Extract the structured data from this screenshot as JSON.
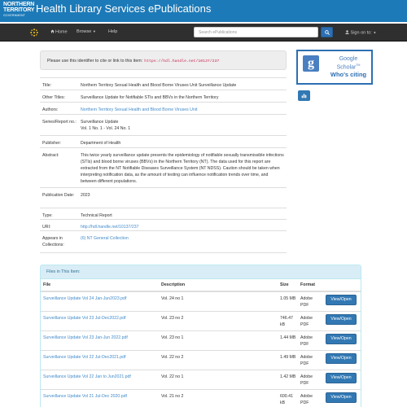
{
  "banner": {
    "logo_line1": "NORTHERN",
    "logo_line2": "TERRITORY",
    "logo_line3": "GOVERNMENT",
    "title": "Health Library Services ePublications",
    "background": "#1d7ab8"
  },
  "navbar": {
    "home": "Home",
    "browse": "Browse",
    "help": "Help",
    "search_placeholder": "Search ePublications",
    "sign_on": "Sign on to:",
    "background": "#2f2f2f"
  },
  "citation": {
    "prompt": "Please use this identifier to cite or link to this item:",
    "url": "https://hdl.handle.net/10137/237"
  },
  "metadata": [
    {
      "label": "Title:",
      "value": "Northern Territory Sexual Health and Blood Borne Viruses Unit Surveillance Update",
      "link": false
    },
    {
      "label": "Other Titles:",
      "value": "Surveillance Update for Notifiable STIs and BBVs in the Northern Territory",
      "link": false
    },
    {
      "label": "Authors:",
      "value": "Northern Territory Sexual Health and Blood Borne Viruses Unit",
      "link": true
    },
    {
      "label": "Series/Report no.:",
      "value": "Surveillance Update\nVol. 1 No. 1 - Vol. 24 No. 1",
      "link": false
    },
    {
      "label": "Publisher:",
      "value": "Department of Health",
      "link": false
    },
    {
      "label": "Abstract:",
      "value": "This twice yearly surveillance update presents the epidemiology of notifiable sexually transmissible infections (STIs) and blood borne viruses (BBVs) in the Northern Territory (NT). The data used for this report are extracted from the NT Notifiable Diseases Surveillance System (NT NDSS). Caution should be taken when interpreting notification data, as the amount of testing can influence notification trends over time, and between different populations.",
      "link": false
    },
    {
      "label": "Publication Date:",
      "value": "2023",
      "link": false
    },
    {
      "label": "Type:",
      "value": "Technical Report",
      "link": false
    },
    {
      "label": "URI:",
      "value": "http://hdl.handle.net/10137/237",
      "link": true
    },
    {
      "label": "Appears in Collections:",
      "value": "(6) NT General Collection",
      "link": true
    }
  ],
  "scholar": {
    "google": "Google",
    "scholar": "Scholar",
    "tm": "TM",
    "whos_citing": "Who's citing"
  },
  "files": {
    "heading": "Files in This Item:",
    "columns": [
      "File",
      "Description",
      "Size",
      "Format"
    ],
    "button_label": "View/Open",
    "rows": [
      {
        "file": "Surveillance Update Vol 24 Jan-Jun2023.pdf",
        "description": "Vol. 24 no 1",
        "size": "1.05 MB",
        "format": "Adobe PDF"
      },
      {
        "file": "Surveillance Update Vol 23 Jul-Dec2022.pdf",
        "description": "Vol. 23 no 2",
        "size": "746.47 kB",
        "format": "Adobe PDF"
      },
      {
        "file": "Surveillance Update Vol 23 Jan-Jun 2022.pdf",
        "description": "Vol. 23 no 1",
        "size": "1.44 MB",
        "format": "Adobe PDF"
      },
      {
        "file": "Surveillance Update Vol 22 Jul-Dec2021.pdf",
        "description": "Vol. 22 no 2",
        "size": "1.49 MB",
        "format": "Adobe PDF"
      },
      {
        "file": "Surveillance Update Vol 22 Jan to Jun2021.pdf",
        "description": "Vol. 22 no 1",
        "size": "1.42 MB",
        "format": "Adobe PDF"
      },
      {
        "file": "Surveillance Update Vol 21 Jul-Dec 2020.pdf",
        "description": "Vol. 21 no 2",
        "size": "600.41 kB",
        "format": "Adobe PDF"
      }
    ]
  },
  "colors": {
    "link": "#428bca",
    "primary_button": "#3278b3",
    "panel_heading": "#d9edf7"
  }
}
